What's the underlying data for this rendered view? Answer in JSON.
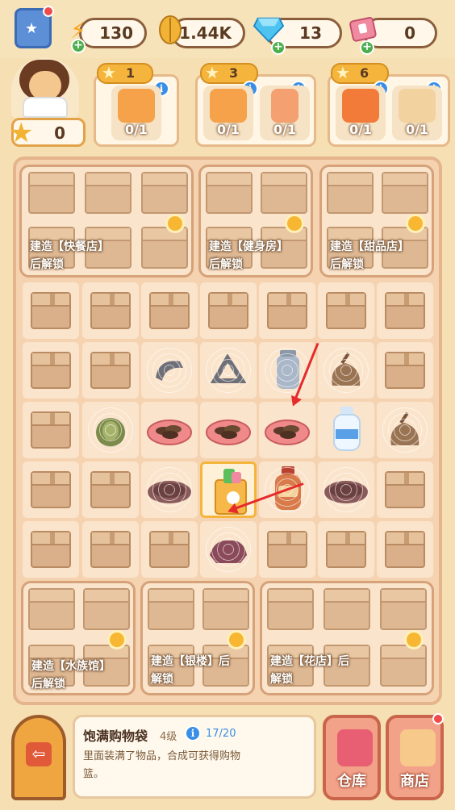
{
  "resources": {
    "energy": "130",
    "coins": "1.44K",
    "gems": "13",
    "tickets": "0"
  },
  "player": {
    "stars": "0"
  },
  "orders": [
    {
      "stars": "1",
      "items": [
        {
          "name": "chips-bag",
          "count": "0/1"
        }
      ]
    },
    {
      "stars": "3",
      "items": [
        {
          "name": "chips-bag",
          "count": "0/1"
        },
        {
          "name": "juice-bottle",
          "count": "0/1"
        }
      ]
    },
    {
      "stars": "6",
      "items": [
        {
          "name": "gift-bag",
          "count": "0/1"
        },
        {
          "name": "toast-bread",
          "count": "0/1"
        }
      ]
    }
  ],
  "locked_areas": {
    "fastfood": "建造【快餐店】\n后解锁",
    "gym": "建造【健身房】\n后解锁",
    "dessert": "建造【甜品店】\n后解锁",
    "aquarium": "建造【水族馆】\n后解锁",
    "bank": "建造【银楼】后\n解锁",
    "flower": "建造【花店】后\n解锁"
  },
  "selected_item": {
    "name": "饱满购物袋",
    "level": "4级",
    "progress": "17/20",
    "description": "里面装满了物品，合成可获得购物篮。"
  },
  "buttons": {
    "warehouse": "仓库",
    "shop": "商店"
  },
  "colors": {
    "accent": "#f5b53c",
    "board": "#f6d3b0",
    "arrow": "#e52b2b"
  }
}
